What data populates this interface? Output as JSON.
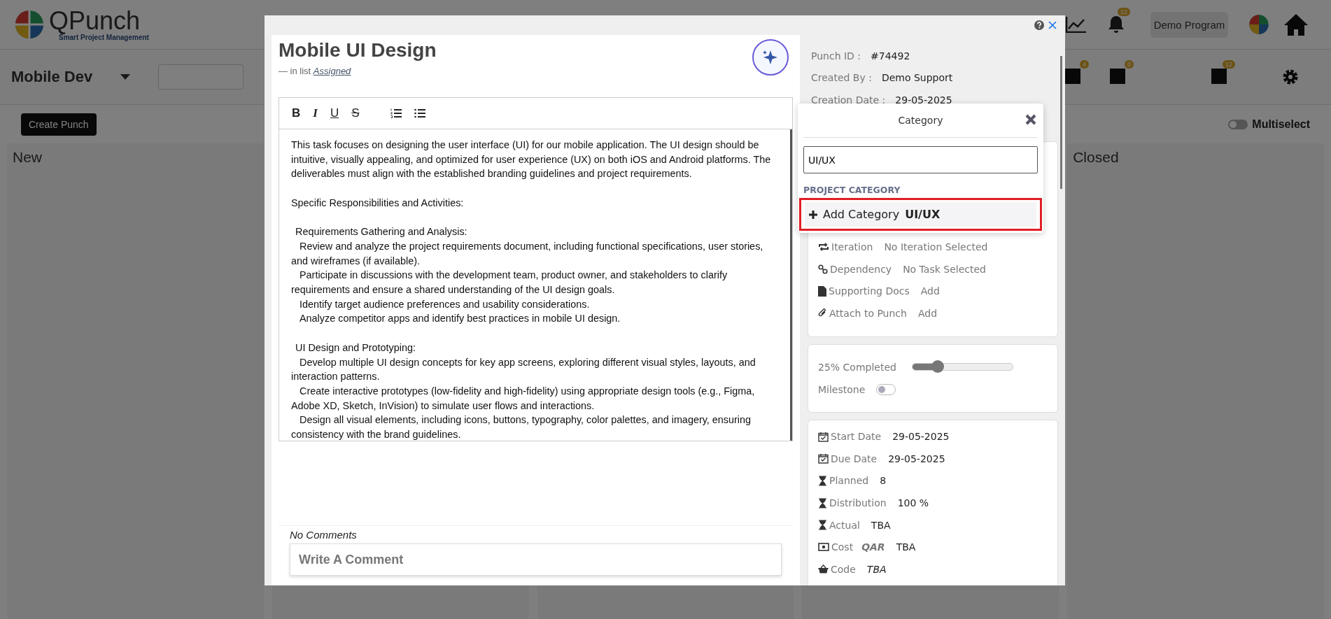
{
  "header": {
    "logo_text": "QPunch",
    "tagline": "Smart Project Management",
    "program_button": "Demo Program",
    "notification_badge": "12"
  },
  "toolbar": {
    "project": "Mobile Dev",
    "badges": [
      "4",
      "0",
      "12"
    ]
  },
  "actions": {
    "create_button": "Create Punch",
    "multiselect": {
      "label": "Multiselect",
      "on": false
    }
  },
  "columns": [
    {
      "title": "New"
    },
    {
      "title": "Closed"
    }
  ],
  "task": {
    "title": "Mobile UI Design",
    "list_prefix": "— in list",
    "list_name": "Assigned"
  },
  "editor": {
    "format_buttons": [
      "B",
      "I",
      "U",
      "S"
    ],
    "paragraphs": [
      {
        "kind": "paragraph",
        "text": "This task focuses on designing the user interface (UI) for our mobile application. The UI design should be intuitive, visually appealing, and optimized for user experience (UX) on both iOS and Android platforms. The deliverables must align with the established branding guidelines and project requirements."
      },
      {
        "kind": "paragraph",
        "text": "Specific Responsibilities and Activities:"
      },
      {
        "kind": "section",
        "text": "Requirements Gathering and Analysis:"
      },
      {
        "kind": "item",
        "text": "Review and analyze the project requirements document, including functional specifications, user stories, and wireframes (if available)."
      },
      {
        "kind": "item",
        "text": "Participate in discussions with the development team, product owner, and stakeholders to clarify requirements and ensure a shared understanding of the UI design goals."
      },
      {
        "kind": "item",
        "text": "Identify target audience preferences and usability considerations."
      },
      {
        "kind": "item",
        "text": "Analyze competitor apps and identify best practices in mobile UI design."
      },
      {
        "kind": "section",
        "text": "UI Design and Prototyping:"
      },
      {
        "kind": "item",
        "text": "Develop multiple UI design concepts for key app screens, exploring different visual styles, layouts, and interaction patterns."
      },
      {
        "kind": "item",
        "text": "Create interactive prototypes (low-fidelity and high-fidelity) using appropriate design tools (e.g., Figma, Adobe XD, Sketch, InVision) to simulate user flows and interactions."
      },
      {
        "kind": "item",
        "text": "Design all visual elements, including icons, buttons, typography, color palettes, and imagery, ensuring consistency with the brand guidelines."
      }
    ]
  },
  "comments": {
    "empty_text": "No Comments",
    "placeholder": "Write A Comment"
  },
  "meta": [
    {
      "label": "Punch ID :",
      "value": "#74492"
    },
    {
      "label": "Created By :",
      "value": "Demo Support"
    },
    {
      "label": "Creation Date :",
      "value": "29-05-2025"
    }
  ],
  "category_popup": {
    "title": "Category",
    "search_value": "UI/UX",
    "section_label": "PROJECT CATEGORY",
    "add_option": "Add Category **UI/UX**"
  },
  "links": [
    {
      "kind": "iteration",
      "label": "Iteration",
      "value": "No Iteration Selected"
    },
    {
      "kind": "dependency",
      "label": "Dependency",
      "value": "No Task Selected"
    },
    {
      "kind": "docs",
      "label": "Supporting Docs",
      "value": "Add"
    },
    {
      "kind": "attach",
      "label": "Attach to Punch",
      "value": "Add"
    }
  ],
  "progress": {
    "label": "25% Completed",
    "level": 0.25
  },
  "milestone": {
    "label": "Milestone",
    "on": false
  },
  "schedule": [
    {
      "kind": "calendar",
      "label": "Start Date",
      "value": "29-05-2025"
    },
    {
      "kind": "calendar",
      "label": "Due Date",
      "value": "29-05-2025"
    },
    {
      "kind": "hourglass",
      "label": "Planned",
      "value": "8"
    },
    {
      "kind": "hourglass",
      "label": "Distribution",
      "value": "100 %"
    },
    {
      "kind": "hourglass",
      "label": "Actual",
      "value": "TBA"
    },
    {
      "kind": "money",
      "label": "Cost",
      "currency": "QAR",
      "value": "TBA"
    },
    {
      "kind": "basket",
      "label": "Code",
      "value": "TBA",
      "italic": true
    }
  ]
}
